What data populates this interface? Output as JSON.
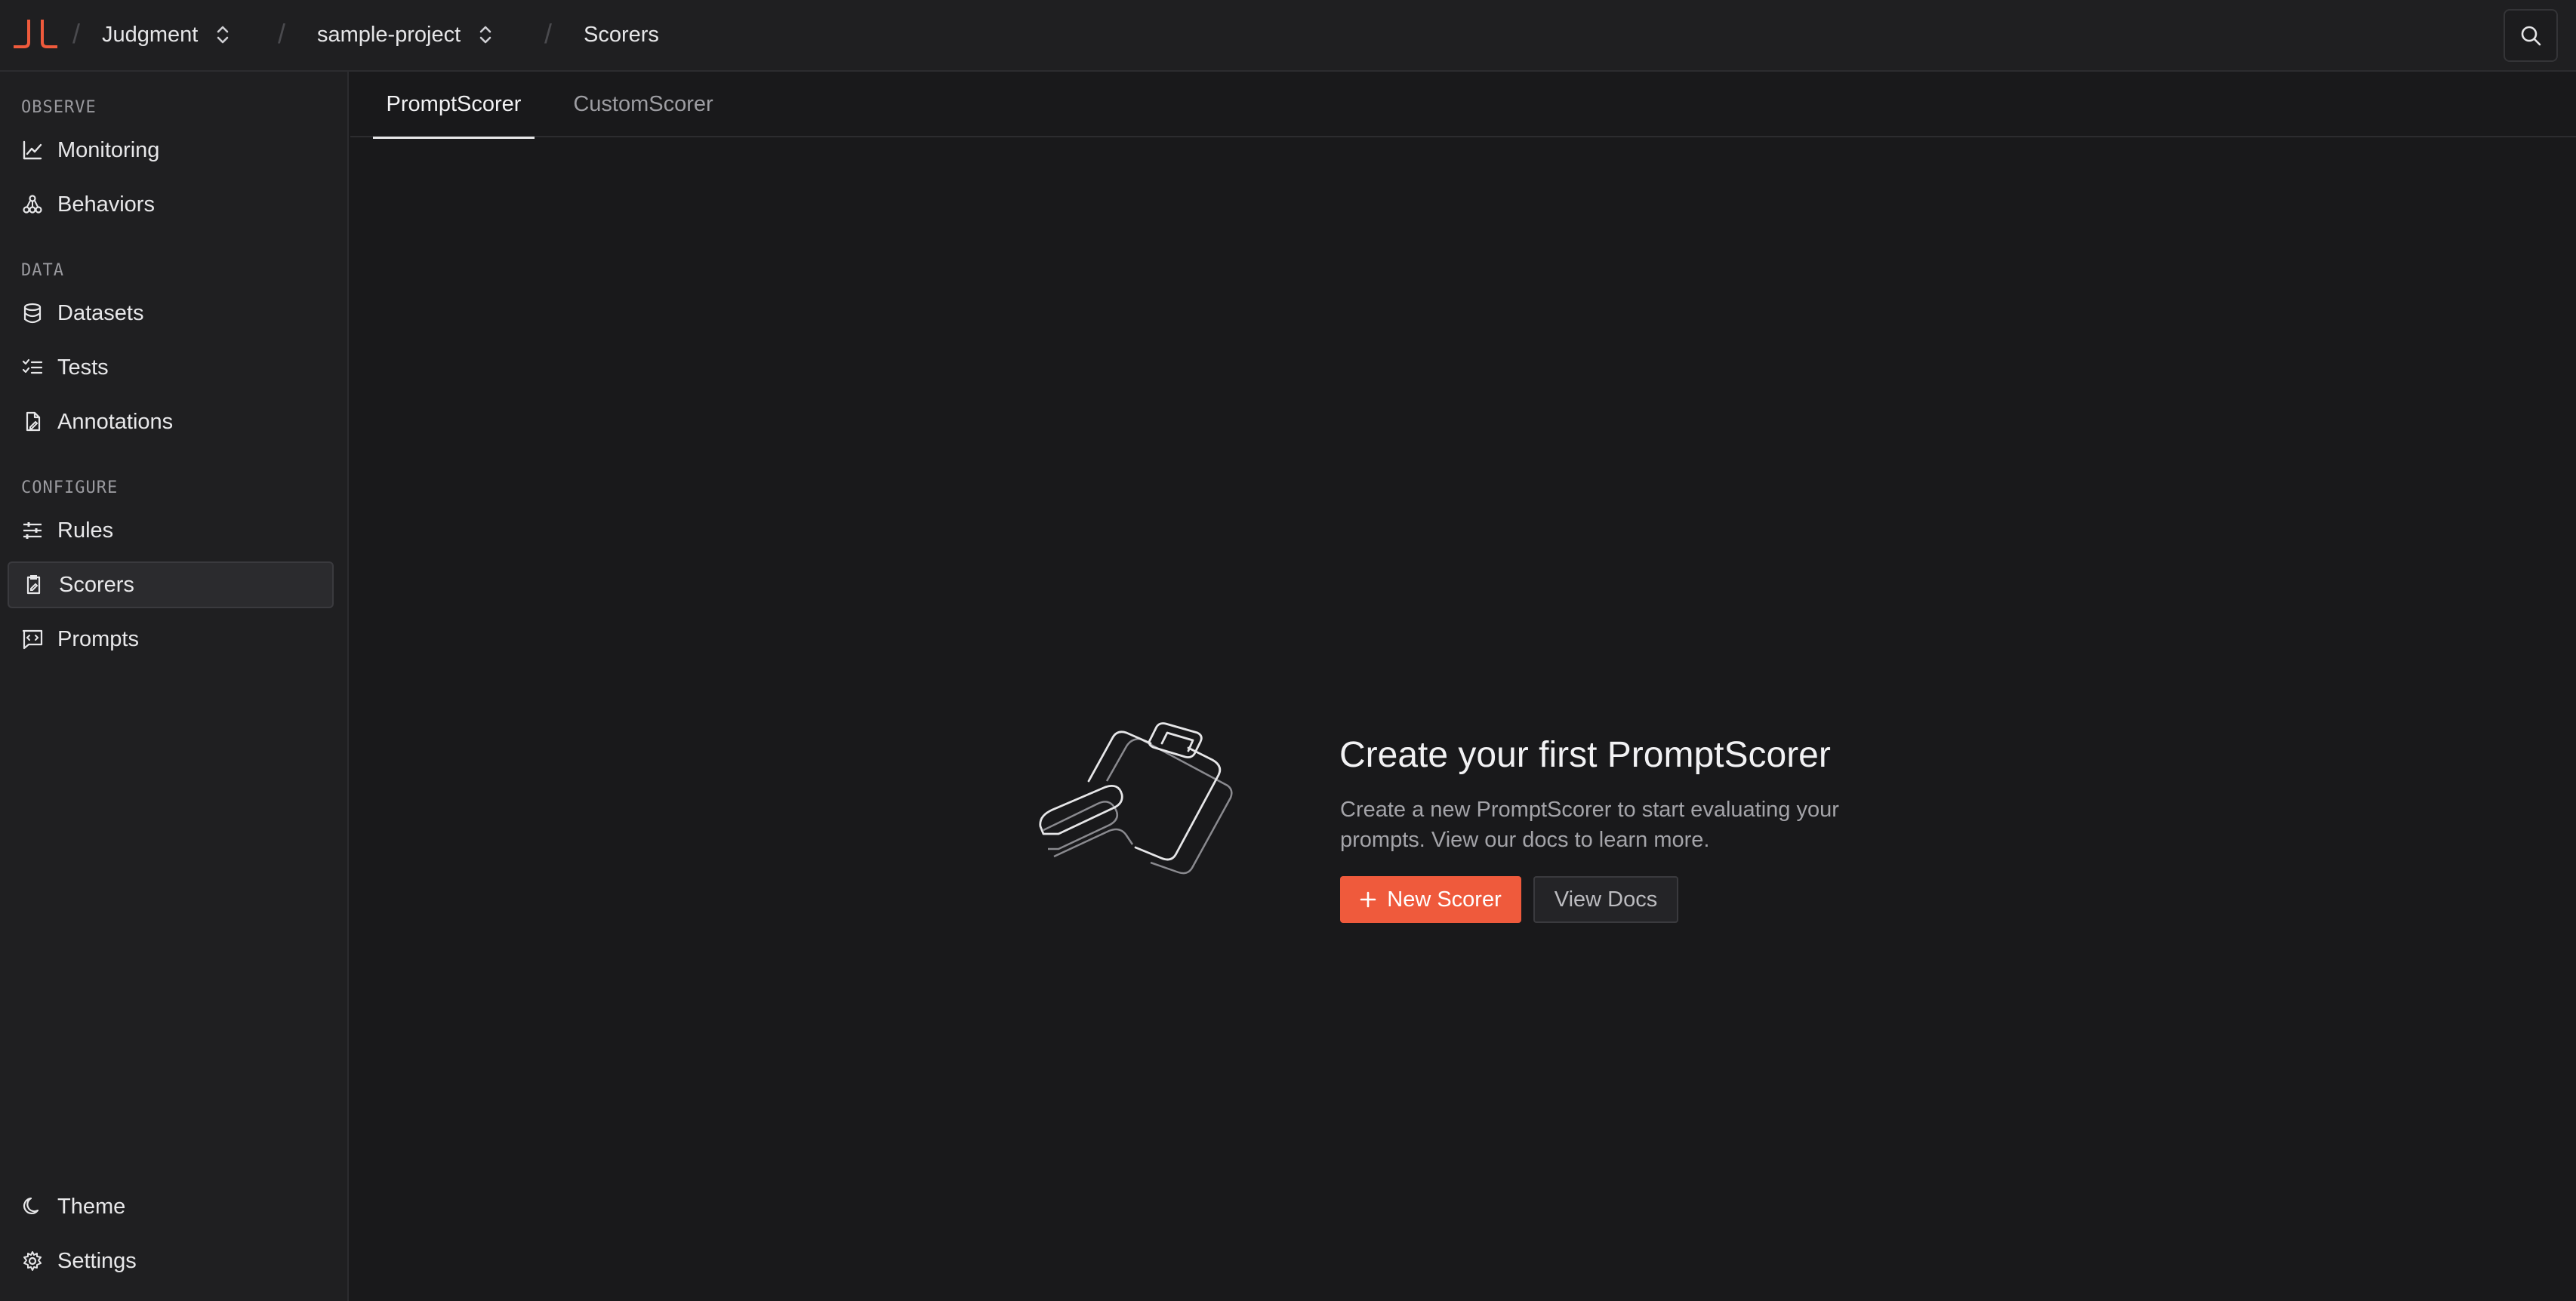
{
  "breadcrumb": {
    "org": "Judgment",
    "project": "sample-project",
    "page": "Scorers",
    "separator": "/"
  },
  "brand": {
    "accent": "#ef5a3c"
  },
  "sidebar": {
    "sections": [
      {
        "label": "OBSERVE",
        "items": [
          {
            "label": "Monitoring",
            "icon": "line-chart-icon"
          },
          {
            "label": "Behaviors",
            "icon": "cluster-icon"
          }
        ]
      },
      {
        "label": "DATA",
        "items": [
          {
            "label": "Datasets",
            "icon": "database-icon"
          },
          {
            "label": "Tests",
            "icon": "checklist-icon"
          },
          {
            "label": "Annotations",
            "icon": "annotation-icon"
          }
        ]
      },
      {
        "label": "CONFIGURE",
        "items": [
          {
            "label": "Rules",
            "icon": "sliders-icon"
          },
          {
            "label": "Scorers",
            "icon": "scorer-icon",
            "active": true
          },
          {
            "label": "Prompts",
            "icon": "prompt-icon"
          }
        ]
      }
    ],
    "footer": [
      {
        "label": "Theme",
        "icon": "moon-icon"
      },
      {
        "label": "Settings",
        "icon": "gear-icon"
      }
    ]
  },
  "tabs": [
    {
      "label": "PromptScorer",
      "active": true
    },
    {
      "label": "CustomScorer",
      "active": false
    }
  ],
  "empty_state": {
    "title": "Create your first PromptScorer",
    "description": "Create a new PromptScorer to start evaluating your prompts. View our docs to learn more.",
    "primary_button": "New Scorer",
    "secondary_button": "View Docs"
  }
}
